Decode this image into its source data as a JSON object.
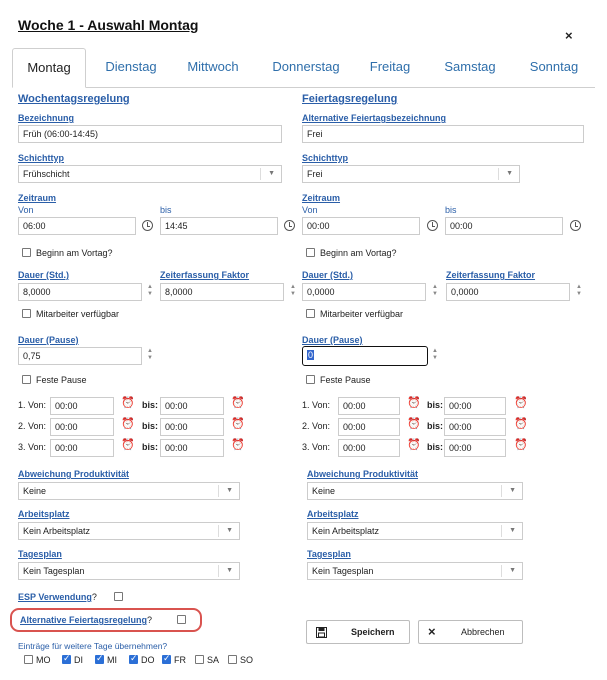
{
  "dialog": {
    "title": "Woche 1 - Auswahl Montag",
    "close_icon": "×"
  },
  "tabs": [
    "Montag",
    "Dienstag",
    "Mittwoch",
    "Donnerstag",
    "Freitag",
    "Samstag",
    "Sonntag"
  ],
  "left": {
    "heading": "Wochentagsregelung",
    "bezeichnung_label": "Bezeichnung",
    "bezeichnung_value": "Früh (06:00-14:45)",
    "schichttyp_label": "Schichttyp",
    "schichttyp_value": "Frühschicht",
    "zeitraum_label": "Zeitraum",
    "von_label": "Von",
    "bis_label": "bis",
    "von_value": "06:00",
    "bis_value": "14:45",
    "beginn_vortag": "Beginn am Vortag?",
    "dauer_label": "Dauer (Std.)",
    "dauer_value": "8,0000",
    "faktor_label": "Zeiterfassung Faktor",
    "faktor_value": "8,0000",
    "mitarbeiter": "Mitarbeiter verfügbar",
    "pause_label": "Dauer (Pause)",
    "pause_value": "0,75",
    "feste_pause": "Feste Pause",
    "rows": [
      {
        "label": "1. Von:",
        "von": "00:00",
        "bis_label": "bis:",
        "bis": "00:00"
      },
      {
        "label": "2. Von:",
        "von": "00:00",
        "bis_label": "bis:",
        "bis": "00:00"
      },
      {
        "label": "3. Von:",
        "von": "00:00",
        "bis_label": "bis:",
        "bis": "00:00"
      }
    ],
    "abweichung_label": "Abweichung Produktivität",
    "abweichung_value": "Keine",
    "arbeitsplatz_label": "Arbeitsplatz",
    "arbeitsplatz_value": "Kein Arbeitsplatz",
    "tagesplan_label": "Tagesplan",
    "tagesplan_value": "Kein Tagesplan"
  },
  "right": {
    "heading": "Feiertagsregelung",
    "bezeichnung_label": "Alternative Feiertagsbezeichnung",
    "bezeichnung_value": "Frei",
    "schichttyp_label": "Schichttyp",
    "schichttyp_value": "Frei",
    "zeitraum_label": "Zeitraum",
    "von_label": "Von",
    "bis_label": "bis",
    "von_value": "00:00",
    "bis_value": "00:00",
    "beginn_vortag": "Beginn am Vortag?",
    "dauer_label": "Dauer (Std.)",
    "dauer_value": "0,0000",
    "faktor_label": "Zeiterfassung Faktor",
    "faktor_value": "0,0000",
    "mitarbeiter": "Mitarbeiter verfügbar",
    "pause_label": "Dauer (Pause)",
    "pause_value": "0",
    "feste_pause": "Feste Pause",
    "rows": [
      {
        "label": "1. Von:",
        "von": "00:00",
        "bis_label": "bis:",
        "bis": "00:00"
      },
      {
        "label": "2. Von:",
        "von": "00:00",
        "bis_label": "bis:",
        "bis": "00:00"
      },
      {
        "label": "3. Von:",
        "von": "00:00",
        "bis_label": "bis:",
        "bis": "00:00"
      }
    ],
    "abweichung_label": "Abweichung Produktivität",
    "abweichung_value": "Keine",
    "arbeitsplatz_label": "Arbeitsplatz",
    "arbeitsplatz_value": "Kein Arbeitsplatz",
    "tagesplan_label": "Tagesplan",
    "tagesplan_value": "Kein Tagesplan"
  },
  "footer": {
    "esp_label": "ESP Verwendung",
    "question_mark": "?",
    "alt_feiertag_label": "Alternative Feiertagsregelung",
    "uebernehmen_label": "Einträge für weitere Tage übernehmen?",
    "days": [
      {
        "label": "MO",
        "checked": false
      },
      {
        "label": "DI",
        "checked": true
      },
      {
        "label": "MI",
        "checked": true
      },
      {
        "label": "DO",
        "checked": true
      },
      {
        "label": "FR",
        "checked": true
      },
      {
        "label": "SA",
        "checked": false
      },
      {
        "label": "SO",
        "checked": false
      }
    ],
    "save_label": "Speichern",
    "cancel_label": "Abbrechen"
  },
  "colors": {
    "link": "#2a5ea8",
    "highlight": "#d9534f",
    "checkbox": "#2b6fd6"
  }
}
